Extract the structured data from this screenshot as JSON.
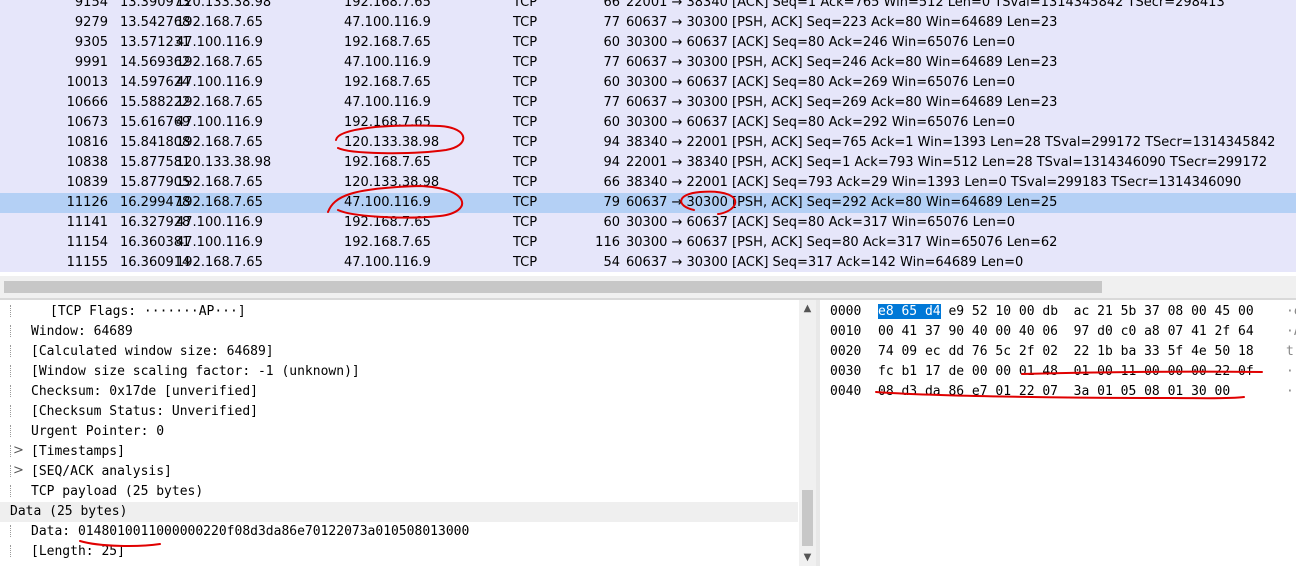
{
  "packets": [
    {
      "no": "9154",
      "time": "13.390973",
      "src": "120.133.38.98",
      "dst": "192.168.7.65",
      "proto": "TCP",
      "len": "66",
      "info": "22001 → 38340 [ACK] Seq=1 Ack=765 Win=512 Len=0 TSval=1314345842 TSecr=298413"
    },
    {
      "no": "9279",
      "time": "13.542768",
      "src": "192.168.7.65",
      "dst": "47.100.116.9",
      "proto": "TCP",
      "len": "77",
      "info": "60637 → 30300 [PSH, ACK] Seq=223 Ack=80 Win=64689 Len=23"
    },
    {
      "no": "9305",
      "time": "13.571231",
      "src": "47.100.116.9",
      "dst": "192.168.7.65",
      "proto": "TCP",
      "len": "60",
      "info": "30300 → 60637 [ACK] Seq=80 Ack=246 Win=65076 Len=0"
    },
    {
      "no": "9991",
      "time": "14.569362",
      "src": "192.168.7.65",
      "dst": "47.100.116.9",
      "proto": "TCP",
      "len": "77",
      "info": "60637 → 30300 [PSH, ACK] Seq=246 Ack=80 Win=64689 Len=23"
    },
    {
      "no": "10013",
      "time": "14.597624",
      "src": "47.100.116.9",
      "dst": "192.168.7.65",
      "proto": "TCP",
      "len": "60",
      "info": "30300 → 60637 [ACK] Seq=80 Ack=269 Win=65076 Len=0"
    },
    {
      "no": "10666",
      "time": "15.588222",
      "src": "192.168.7.65",
      "dst": "47.100.116.9",
      "proto": "TCP",
      "len": "77",
      "info": "60637 → 30300 [PSH, ACK] Seq=269 Ack=80 Win=64689 Len=23"
    },
    {
      "no": "10673",
      "time": "15.616769",
      "src": "47.100.116.9",
      "dst": "192.168.7.65",
      "proto": "TCP",
      "len": "60",
      "info": "30300 → 60637 [ACK] Seq=80 Ack=292 Win=65076 Len=0"
    },
    {
      "no": "10816",
      "time": "15.841808",
      "src": "192.168.7.65",
      "dst": "120.133.38.98",
      "proto": "TCP",
      "len": "94",
      "info": "38340 → 22001 [PSH, ACK] Seq=765 Ack=1 Win=1393 Len=28 TSval=299172 TSecr=1314345842"
    },
    {
      "no": "10838",
      "time": "15.877581",
      "src": "120.133.38.98",
      "dst": "192.168.7.65",
      "proto": "TCP",
      "len": "94",
      "info": "22001 → 38340 [PSH, ACK] Seq=1 Ack=793 Win=512 Len=28 TSval=1314346090 TSecr=299172"
    },
    {
      "no": "10839",
      "time": "15.877905",
      "src": "192.168.7.65",
      "dst": "120.133.38.98",
      "proto": "TCP",
      "len": "66",
      "info": "38340 → 22001 [ACK] Seq=793 Ack=29 Win=1393 Len=0 TSval=299183 TSecr=1314346090"
    },
    {
      "no": "11126",
      "time": "16.299478",
      "src": "192.168.7.65",
      "dst": "47.100.116.9",
      "proto": "TCP",
      "len": "79",
      "info": "60637 → 30300 [PSH, ACK] Seq=292 Ack=80 Win=64689 Len=25",
      "selected": true
    },
    {
      "no": "11141",
      "time": "16.327928",
      "src": "47.100.116.9",
      "dst": "192.168.7.65",
      "proto": "TCP",
      "len": "60",
      "info": "30300 → 60637 [ACK] Seq=80 Ack=317 Win=65076 Len=0"
    },
    {
      "no": "11154",
      "time": "16.360381",
      "src": "47.100.116.9",
      "dst": "192.168.7.65",
      "proto": "TCP",
      "len": "116",
      "info": "30300 → 60637 [PSH, ACK] Seq=80 Ack=317 Win=65076 Len=62"
    },
    {
      "no": "11155",
      "time": "16.360914",
      "src": "192.168.7.65",
      "dst": "47.100.116.9",
      "proto": "TCP",
      "len": "54",
      "info": "60637 → 30300 [ACK] Seq=317 Ack=142 Win=64689 Len=0"
    }
  ],
  "details": [
    {
      "text": "[TCP Flags: ·······AP···]",
      "indent": 2,
      "expander": ""
    },
    {
      "text": "Window: 64689",
      "indent": 1,
      "expander": ""
    },
    {
      "text": "[Calculated window size: 64689]",
      "indent": 1,
      "expander": ""
    },
    {
      "text": "[Window size scaling factor: -1 (unknown)]",
      "indent": 1,
      "expander": ""
    },
    {
      "text": "Checksum: 0x17de [unverified]",
      "indent": 1,
      "expander": ""
    },
    {
      "text": "[Checksum Status: Unverified]",
      "indent": 1,
      "expander": ""
    },
    {
      "text": "Urgent Pointer: 0",
      "indent": 1,
      "expander": ""
    },
    {
      "text": "[Timestamps]",
      "indent": 1,
      "expander": ">"
    },
    {
      "text": "[SEQ/ACK analysis]",
      "indent": 1,
      "expander": ">"
    },
    {
      "text": "TCP payload (25 bytes)",
      "indent": 1,
      "expander": ""
    },
    {
      "text": "Data (25 bytes)",
      "indent": 0,
      "expander": "",
      "highlight": true
    },
    {
      "text": "Data: 0148010011000000220f08d3da86e70122073a010508013000",
      "indent": 1,
      "expander": ""
    },
    {
      "text": "[Length: 25]",
      "indent": 1,
      "expander": ""
    }
  ],
  "bytes": [
    {
      "offset": "0000",
      "sel": "e8 65 d4",
      "hex": " e9 52 10 00 db  ac 21 5b 37 08 00 45 00",
      "ascii": "·e"
    },
    {
      "offset": "0010",
      "sel": "",
      "hex": "00 41 37 90 40 00 40 06  97 d0 c0 a8 07 41 2f 64",
      "ascii": "·A"
    },
    {
      "offset": "0020",
      "sel": "",
      "hex": "74 09 ec dd 76 5c 2f 02  22 1b ba 33 5f 4e 50 18",
      "ascii": "t·"
    },
    {
      "offset": "0030",
      "sel": "",
      "hex": "fc b1 17 de 00 00 01 48  01 00 11 00 00 00 22 0f",
      "ascii": "··"
    },
    {
      "offset": "0040",
      "sel": "",
      "hex": "08 d3 da 86 e7 01 22 07  3a 01 05 08 01 30 00",
      "ascii": "··"
    }
  ],
  "scroll_arrows": {
    "up": "▲",
    "down": "▼"
  },
  "colors": {
    "row_bg": "#e6e6fa",
    "selected_bg": "#b4d0f5",
    "annotation": "#e00000",
    "byte_selection": "#0078d7"
  }
}
